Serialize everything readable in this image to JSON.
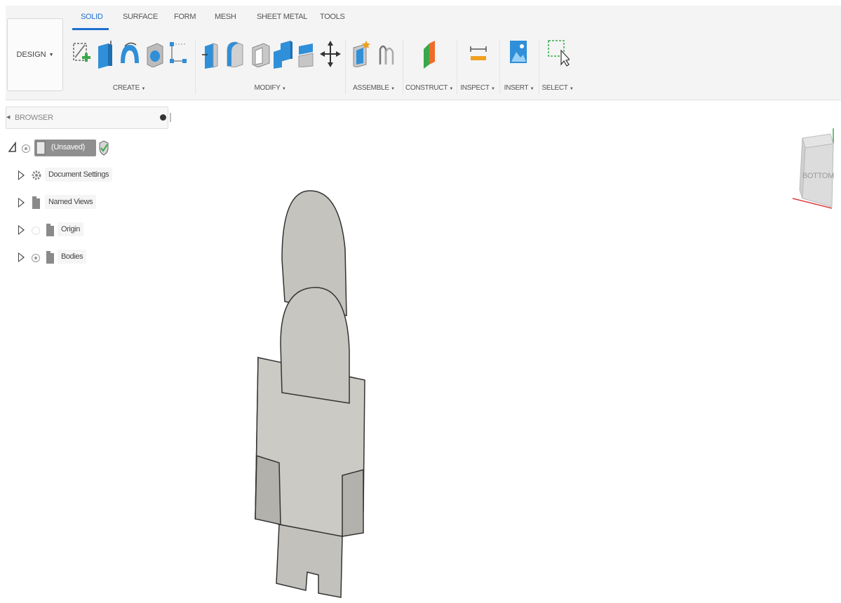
{
  "workspace": {
    "label": "DESIGN"
  },
  "tabs": [
    {
      "label": "SOLID",
      "active": true
    },
    {
      "label": "SURFACE",
      "active": false
    },
    {
      "label": "FORM",
      "active": false
    },
    {
      "label": "MESH",
      "active": false
    },
    {
      "label": "SHEET METAL",
      "active": false
    },
    {
      "label": "TOOLS",
      "active": false
    }
  ],
  "groups": {
    "create": "CREATE",
    "modify": "MODIFY",
    "assemble": "ASSEMBLE",
    "construct": "CONSTRUCT",
    "inspect": "INSPECT",
    "insert": "INSERT",
    "select": "SELECT"
  },
  "browser": {
    "title": "BROWSER",
    "root": {
      "label": "(Unsaved)"
    },
    "items": [
      {
        "label": "Document Settings",
        "icon": "gear-icon"
      },
      {
        "label": "Named Views",
        "icon": "folder-icon"
      },
      {
        "label": "Origin",
        "icon": "folder-icon"
      },
      {
        "label": "Bodies",
        "icon": "folder-icon"
      }
    ]
  },
  "viewcube": {
    "face": "BOTTOM"
  },
  "colors": {
    "accent": "#1e6fd0",
    "tool_blue": "#2f8fd8",
    "tool_green": "#3aa84a",
    "tool_orange": "#f0a020",
    "model_face": "#c9c8c3",
    "model_side": "#a9a8a3"
  }
}
